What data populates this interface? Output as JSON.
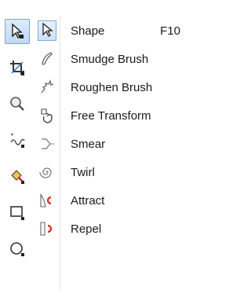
{
  "toolbox": {
    "tools": [
      {
        "name": "shape-tool-icon",
        "active": true
      },
      {
        "name": "crop-tool-icon",
        "active": false
      },
      {
        "name": "zoom-tool-icon",
        "active": false
      },
      {
        "name": "freehand-tool-icon",
        "active": false
      },
      {
        "name": "smart-fill-tool-icon",
        "active": false
      },
      {
        "name": "rectangle-tool-icon",
        "active": false
      },
      {
        "name": "ellipse-tool-icon",
        "active": false
      }
    ]
  },
  "flyout": {
    "items": [
      {
        "label": "Shape",
        "shortcut": "F10",
        "icon": "shape-icon",
        "selected": true
      },
      {
        "label": "Smudge Brush",
        "shortcut": "",
        "icon": "smudge-brush-icon"
      },
      {
        "label": "Roughen Brush",
        "shortcut": "",
        "icon": "roughen-brush-icon"
      },
      {
        "label": "Free Transform",
        "shortcut": "",
        "icon": "free-transform-icon"
      },
      {
        "label": "Smear",
        "shortcut": "",
        "icon": "smear-icon"
      },
      {
        "label": "Twirl",
        "shortcut": "",
        "icon": "twirl-icon"
      },
      {
        "label": "Attract",
        "shortcut": "",
        "icon": "attract-icon"
      },
      {
        "label": "Repel",
        "shortcut": "",
        "icon": "repel-icon"
      }
    ]
  },
  "colors": {
    "accent_red": "#e0241b",
    "accent_blue": "#7da2ce"
  }
}
